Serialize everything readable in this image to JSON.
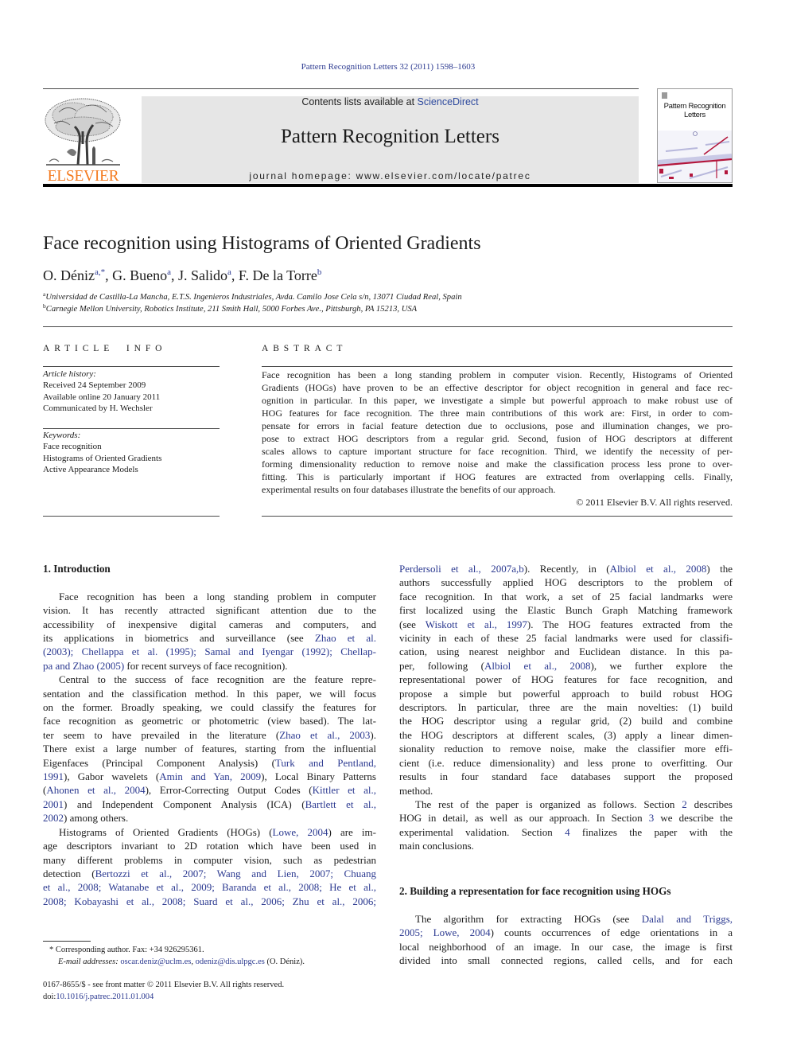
{
  "journal_citation": "Pattern Recognition Letters 32 (2011) 1598–1603",
  "header": {
    "contents_prefix": "Contents lists available at ",
    "contents_link": "ScienceDirect",
    "journal_name": "Pattern Recognition Letters",
    "homepage": "journal homepage: www.elsevier.com/locate/patrec",
    "publisher_logo_text": "ELSEVIER",
    "cover_title_line1": "Pattern Recognition",
    "cover_title_line2": "Letters"
  },
  "colors": {
    "link": "#2b3990",
    "publisher_orange": "#f47b20",
    "header_box": "#e6e6e6"
  },
  "article": {
    "title": "Face recognition using Histograms of Oriented Gradients",
    "author_separator": ", ",
    "authors": [
      {
        "name": "O. Déniz",
        "sup": "a,*"
      },
      {
        "name": "G. Bueno",
        "sup": "a"
      },
      {
        "name": "J. Salido",
        "sup": "a"
      },
      {
        "name": "F. De la Torre",
        "sup": "b"
      }
    ],
    "affiliations": [
      {
        "mark": "a",
        "text": "Universidad de Castilla-La Mancha, E.T.S. Ingenieros Industriales, Avda. Camilo Jose Cela s/n, 13071 Ciudad Real, Spain"
      },
      {
        "mark": "b",
        "text": "Carnegie Mellon University, Robotics Institute, 211 Smith Hall, 5000 Forbes Ave., Pittsburgh, PA 15213, USA"
      }
    ]
  },
  "article_info": {
    "heading": "ARTICLE INFO",
    "history_label": "Article history:",
    "history": [
      "Received 24 September 2009",
      "Available online 20 January 2011",
      "Communicated by H. Wechsler"
    ],
    "keywords_label": "Keywords:",
    "keywords": [
      "Face recognition",
      "Histograms of Oriented Gradients",
      "Active Appearance Models"
    ]
  },
  "abstract": {
    "heading": "ABSTRACT",
    "lines": [
      "Face recognition has been a long standing problem in computer vision. Recently, Histograms of Oriented",
      "Gradients (HOGs) have proven to be an effective descriptor for object recognition in general and face rec-",
      "ognition in particular. In this paper, we investigate a simple but powerful approach to make robust use of",
      "HOG features for face recognition. The three main contributions of this work are: First, in order to com-",
      "pensate for errors in facial feature detection due to occlusions, pose and illumination changes, we pro-",
      "pose to extract HOG descriptors from a regular grid. Second, fusion of HOG descriptors at different",
      "scales allows to capture important structure for face recognition. Third, we identify the necessity of per-",
      "forming dimensionality reduction to remove noise and make the classification process less prone to over-",
      "fitting. This is particularly important if HOG features are extracted from overlapping cells. Finally,",
      "experimental results on four databases illustrate the benefits of our approach."
    ],
    "copyright": "© 2011 Elsevier B.V. All rights reserved."
  },
  "body": {
    "left": [
      {
        "type": "heading",
        "text": "1. Introduction"
      },
      {
        "type": "para",
        "indent": true,
        "end": true,
        "lines": [
          "Face recognition has been a long standing problem in computer",
          "vision. It has recently attracted significant attention due to the",
          "accessibility of inexpensive digital cameras and computers, and",
          [
            "its applications in biometrics and surveillance (see ",
            {
              "link": "Zhao et al."
            }
          ],
          [
            {
              "link": "(2003); Chellappa et al. (1995); Samal and Iyengar (1992); Chellap-"
            }
          ],
          [
            {
              "link": "pa and Zhao (2005)"
            },
            " for recent surveys of face recognition)."
          ]
        ]
      },
      {
        "type": "para",
        "indent": true,
        "end": true,
        "lines": [
          "Central to the success of face recognition are the feature repre-",
          "sentation and the classification method. In this paper, we will focus",
          "on the former. Broadly speaking, we could classify the features for",
          "face recognition as geometric or photometric (view based). The lat-",
          [
            "ter seem to have prevailed in the literature (",
            {
              "link": "Zhao et al., 2003"
            },
            ")."
          ],
          "There exist a large number of features, starting from the influential",
          [
            "Eigenfaces (Principal Component Analysis) (",
            {
              "link": "Turk and Pentland,"
            }
          ],
          [
            {
              "link": "1991"
            },
            "), Gabor wavelets (",
            {
              "link": "Amin and Yan, 2009"
            },
            "), Local Binary Patterns"
          ],
          [
            "(",
            {
              "link": "Ahonen et al., 2004"
            },
            "), Error-Correcting Output Codes (",
            {
              "link": "Kittler et al.,"
            }
          ],
          [
            {
              "link": "2001"
            },
            ") and Independent Component Analysis (ICA) (",
            {
              "link": "Bartlett et al.,"
            }
          ],
          [
            {
              "link": "2002"
            },
            ") among others."
          ]
        ]
      },
      {
        "type": "para",
        "indent": true,
        "end": false,
        "lines": [
          [
            "Histograms of Oriented Gradients (HOGs) (",
            {
              "link": "Lowe, 2004"
            },
            ") are im-"
          ],
          "age descriptors invariant to 2D rotation which have been used in",
          "many different problems in computer vision, such as pedestrian",
          [
            "detection (",
            {
              "link": "Bertozzi et al., 2007; Wang and Lien, 2007; Chuang"
            }
          ],
          [
            {
              "link": "et al., 2008; Watanabe et al., 2009; Baranda et al., 2008; He et al.,"
            }
          ],
          [
            {
              "link": "2008; Kobayashi et al., 2008; Suard et al., 2006; Zhu et al., 2006;"
            }
          ]
        ]
      }
    ],
    "right": [
      {
        "type": "para",
        "indent": false,
        "end": true,
        "lines": [
          [
            {
              "link": "Perdersoli et al., 2007a,b"
            },
            "). Recently, in (",
            {
              "link": "Albiol et al., 2008"
            },
            ") the"
          ],
          "authors successfully applied HOG descriptors to the problem of",
          "face recognition. In that work, a set of 25 facial landmarks were",
          "first localized using the Elastic Bunch Graph Matching framework",
          [
            "(see ",
            {
              "link": "Wiskott et al., 1997"
            },
            "). The HOG features extracted from the"
          ],
          "vicinity in each of these 25 facial landmarks were used for classifi-",
          "cation, using nearest neighbor and Euclidean distance. In this pa-",
          [
            "per, following (",
            {
              "link": "Albiol et al., 2008"
            },
            "), we further explore the"
          ],
          "representational power of HOG features for face recognition, and",
          "propose a simple but powerful approach to build robust HOG",
          "descriptors. In particular, three are the main novelties: (1) build",
          "the HOG descriptor using a regular grid, (2) build and combine",
          "the HOG descriptors at different scales, (3) apply a linear dimen-",
          "sionality reduction to remove noise, make the classifier more effi-",
          "cient (i.e. reduce dimensionality) and less prone to overfitting. Our",
          "results in four standard face databases support the proposed",
          "method."
        ]
      },
      {
        "type": "para",
        "indent": true,
        "end": true,
        "lines": [
          [
            "The rest of the paper is organized as follows. Section ",
            {
              "link": "2"
            },
            " describes"
          ],
          [
            "HOG in detail, as well as our approach. In Section ",
            {
              "link": "3"
            },
            " we describe the"
          ],
          [
            "experimental validation. Section ",
            {
              "link": "4"
            },
            " finalizes the paper with the"
          ],
          "main conclusions."
        ]
      },
      {
        "type": "heading",
        "text": "2. Building a representation for face recognition using HOGs"
      },
      {
        "type": "para",
        "indent": true,
        "end": false,
        "lines": [
          [
            "The algorithm for extracting HOGs (see ",
            {
              "link": "Dalal and Triggs,"
            }
          ],
          [
            {
              "link": "2005; Lowe, 2004"
            },
            ") counts occurrences of edge orientations in a"
          ],
          "local neighborhood of an image. In our case, the image is first",
          "divided into small connected regions, called cells, and for each"
        ]
      }
    ]
  },
  "footnotes": {
    "corresponding_mark": "*",
    "corresponding": " Corresponding author. Fax: +34 926295361.",
    "email_label": "E-mail addresses: ",
    "emails": [
      "oscar.deniz@uclm.es",
      "odeniz@dis.ulpgc.es"
    ],
    "email_separator": ", ",
    "email_owner": " (O. Déniz)."
  },
  "front_matter": {
    "issn_line": "0167-8655/$ - see front matter © 2011 Elsevier B.V. All rights reserved.",
    "doi_label": "doi:",
    "doi": "10.1016/j.patrec.2011.01.004"
  }
}
